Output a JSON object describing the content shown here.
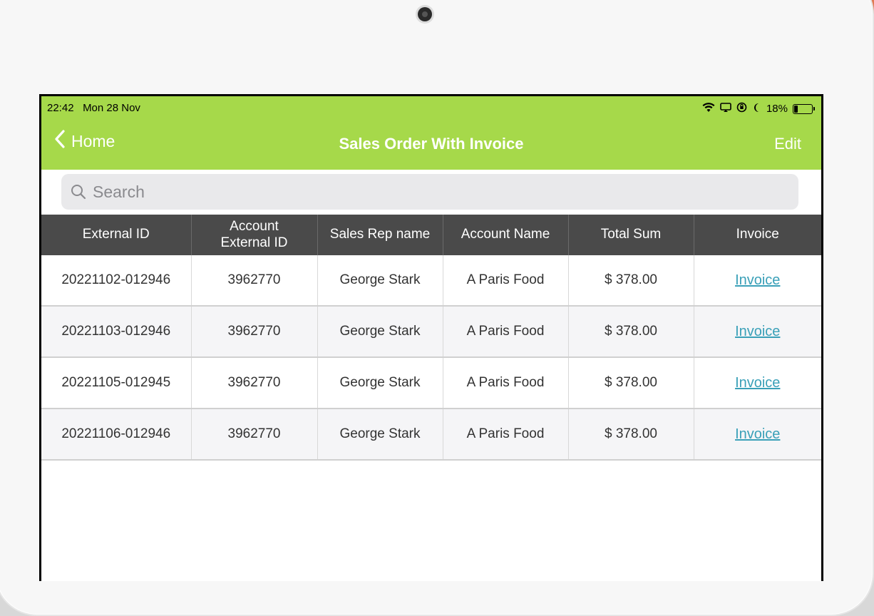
{
  "status_bar": {
    "time": "22:42",
    "date": "Mon 28 Nov",
    "battery": "18%",
    "icons": [
      "wifi-icon",
      "screen-mirror-icon",
      "orientation-lock-icon",
      "moon-icon",
      "battery-icon"
    ]
  },
  "nav": {
    "back_label": "Home",
    "title": "Sales Order With Invoice",
    "edit_label": "Edit"
  },
  "search": {
    "placeholder": "Search"
  },
  "table": {
    "columns": [
      "External ID",
      "Account External ID",
      "Sales Rep name",
      "Account Name",
      "Total Sum",
      "Invoice"
    ],
    "column_lines": {
      "col1_line1": "Account",
      "col1_line2": "External ID"
    },
    "rows": [
      {
        "external_id": "20221102-012946",
        "account_external_id": "3962770",
        "sales_rep": "George Stark",
        "account_name": "A Paris Food",
        "total": "$ 378.00",
        "invoice": "Invoice"
      },
      {
        "external_id": "20221103-012946",
        "account_external_id": "3962770",
        "sales_rep": "George Stark",
        "account_name": "A Paris Food",
        "total": "$ 378.00",
        "invoice": "Invoice"
      },
      {
        "external_id": "20221105-012945",
        "account_external_id": "3962770",
        "sales_rep": "George Stark",
        "account_name": "A Paris Food",
        "total": "$ 378.00",
        "invoice": "Invoice"
      },
      {
        "external_id": "20221106-012946",
        "account_external_id": "3962770",
        "sales_rep": "George Stark",
        "account_name": "A Paris Food",
        "total": "$ 378.00",
        "invoice": "Invoice"
      }
    ]
  },
  "colors": {
    "header_green": "#a6d94a",
    "table_header": "#4a4a4a",
    "link": "#3aa0b8"
  }
}
